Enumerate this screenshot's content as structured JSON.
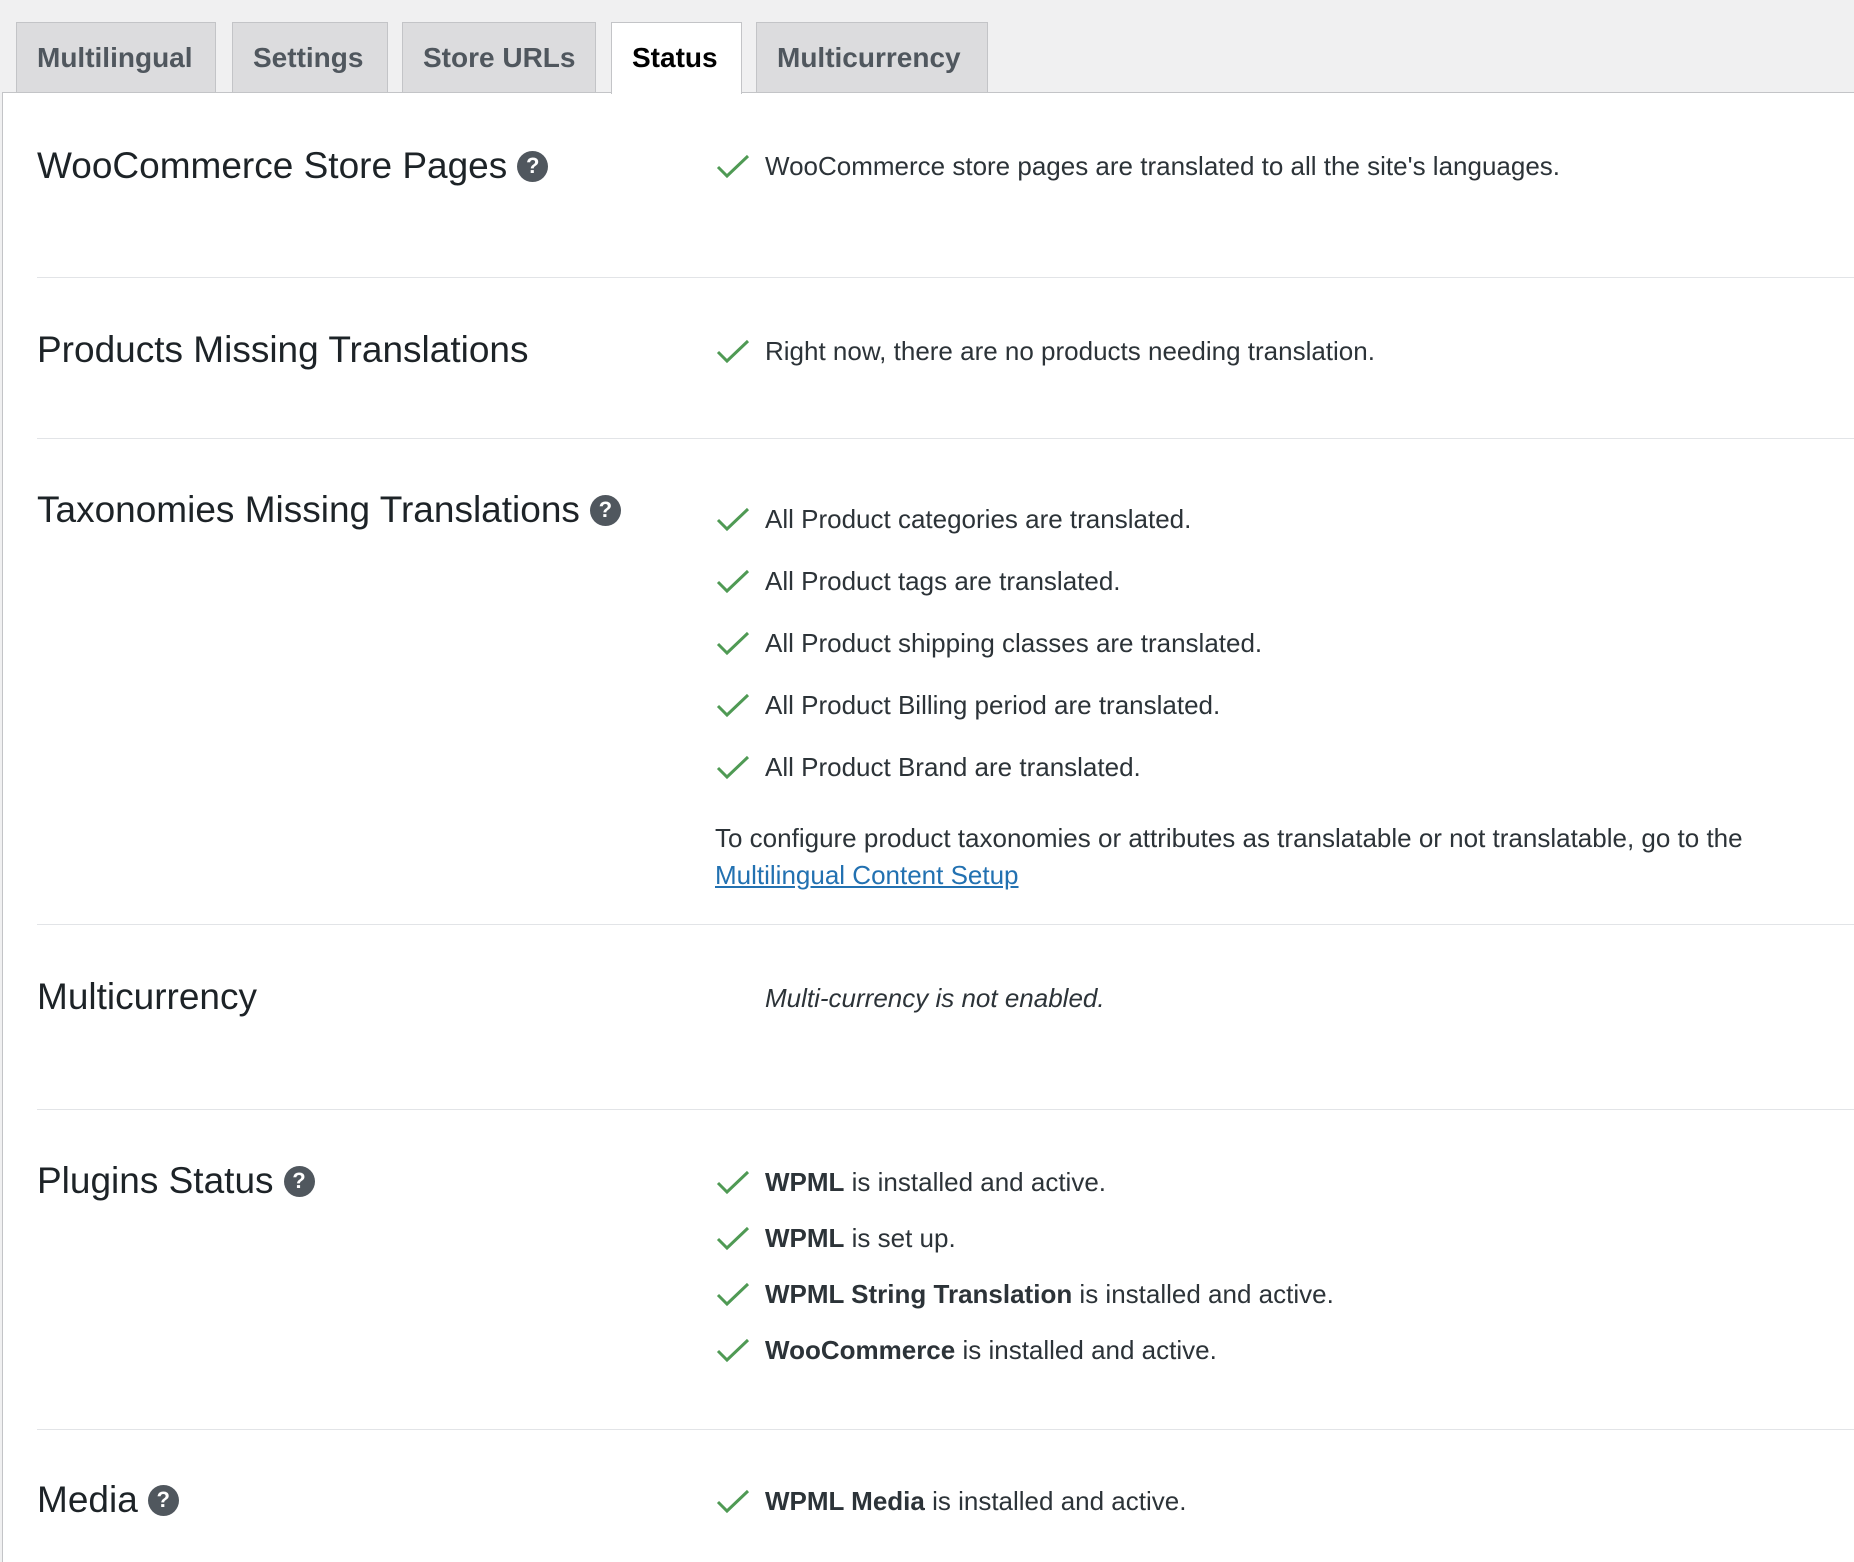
{
  "tabs": [
    {
      "label": "Multilingual",
      "active": false
    },
    {
      "label": "Settings",
      "active": false
    },
    {
      "label": "Store URLs",
      "active": false
    },
    {
      "label": "Status",
      "active": true
    },
    {
      "label": "Multicurrency",
      "active": false
    }
  ],
  "colors": {
    "check": "#4f9a54",
    "link": "#2271b1",
    "help_icon": "#50575e"
  },
  "sections": {
    "store_pages": {
      "title": "WooCommerce Store Pages",
      "items": [
        "WooCommerce store pages are translated to all the site's languages."
      ]
    },
    "products": {
      "title": "Products Missing Translations",
      "items": [
        "Right now, there are no products needing translation."
      ]
    },
    "taxonomies": {
      "title": "Taxonomies Missing Translations",
      "items": [
        "All Product categories are translated.",
        "All Product tags are translated.",
        "All Product shipping classes are translated.",
        "All Product Billing period are translated.",
        "All Product Brand are translated."
      ],
      "note": "To configure product taxonomies or attributes as translatable or not translatable, go to the",
      "note_link": "Multilingual Content Setup"
    },
    "multicurrency": {
      "title": "Multicurrency",
      "note": "Multi-currency is not enabled."
    },
    "plugins": {
      "title": "Plugins Status",
      "items": [
        {
          "name": "WPML",
          "text": " is installed and active."
        },
        {
          "name": "WPML",
          "text": " is set up."
        },
        {
          "name": "WPML String Translation",
          "text": " is installed and active."
        },
        {
          "name": "WooCommerce",
          "text": " is installed and active."
        }
      ]
    },
    "media": {
      "title": "Media",
      "items": [
        {
          "name": "WPML Media",
          "text": " is installed and active."
        }
      ]
    }
  }
}
